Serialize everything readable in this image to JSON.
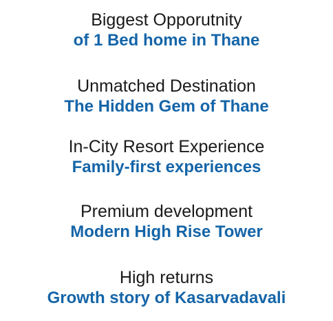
{
  "features": [
    {
      "title": "Biggest Opporutnity",
      "subtitle": "of 1 Bed home in Thane"
    },
    {
      "title": "Unmatched Destination",
      "subtitle": "The Hidden Gem of Thane"
    },
    {
      "title": "In-City Resort Experience",
      "subtitle": "Family-first experiences"
    },
    {
      "title": "Premium development",
      "subtitle": "Modern High Rise Tower"
    },
    {
      "title": "High returns",
      "subtitle": "Growth story of Kasarvadavali"
    }
  ],
  "colors": {
    "title_text": "#1a1a1a",
    "subtitle_text": "#1565a8",
    "background": "#ffffff"
  }
}
